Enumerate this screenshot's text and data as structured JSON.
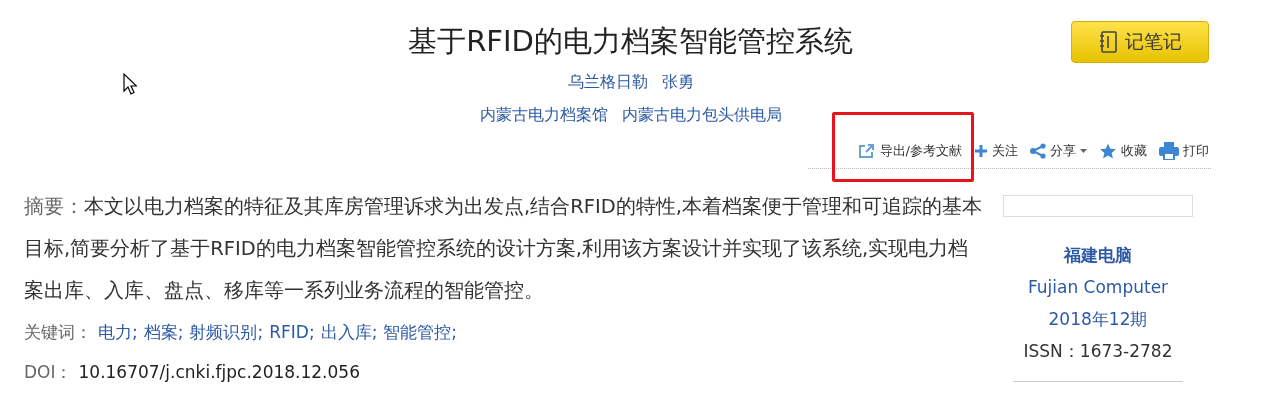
{
  "title": "基于RFID的电力档案智能管控系统",
  "note_button": {
    "label": "记笔记"
  },
  "authors": [
    "乌兰格日勒",
    "张勇"
  ],
  "affiliations": [
    "内蒙古电力档案馆",
    "内蒙古电力包头供电局"
  ],
  "toolbar": [
    {
      "kind": "export",
      "label": "导出/参考文献",
      "highlighted": true
    },
    {
      "kind": "follow",
      "label": "关注",
      "highlighted": false
    },
    {
      "kind": "share",
      "label": "分享",
      "highlighted": false
    },
    {
      "kind": "collect",
      "label": "收藏",
      "highlighted": false
    },
    {
      "kind": "print",
      "label": "打印",
      "highlighted": false
    }
  ],
  "abstract": {
    "label": "摘要：",
    "text": "本文以电力档案的特征及其库房管理诉求为出发点,结合RFID的特性,本着档案便于管理和可追踪的基本目标,简要分析了基于RFID的电力档案智能管控系统的设计方案,利用该方案设计并实现了该系统,实现电力档案出库、入库、盘点、移库等一系列业务流程的智能管控。"
  },
  "keywords": {
    "label": "关键词：",
    "items": [
      "电力;",
      "档案;",
      "射频识别;",
      "RFID;",
      "出入库;",
      "智能管控;"
    ]
  },
  "doi": {
    "label": "DOI：",
    "value": "10.16707/j.cnki.fjpc.2018.12.056"
  },
  "journal": {
    "name": "福建电脑",
    "name_en": "Fujian Computer",
    "issue": "2018年12期",
    "issn": "ISSN：1673-2782"
  }
}
